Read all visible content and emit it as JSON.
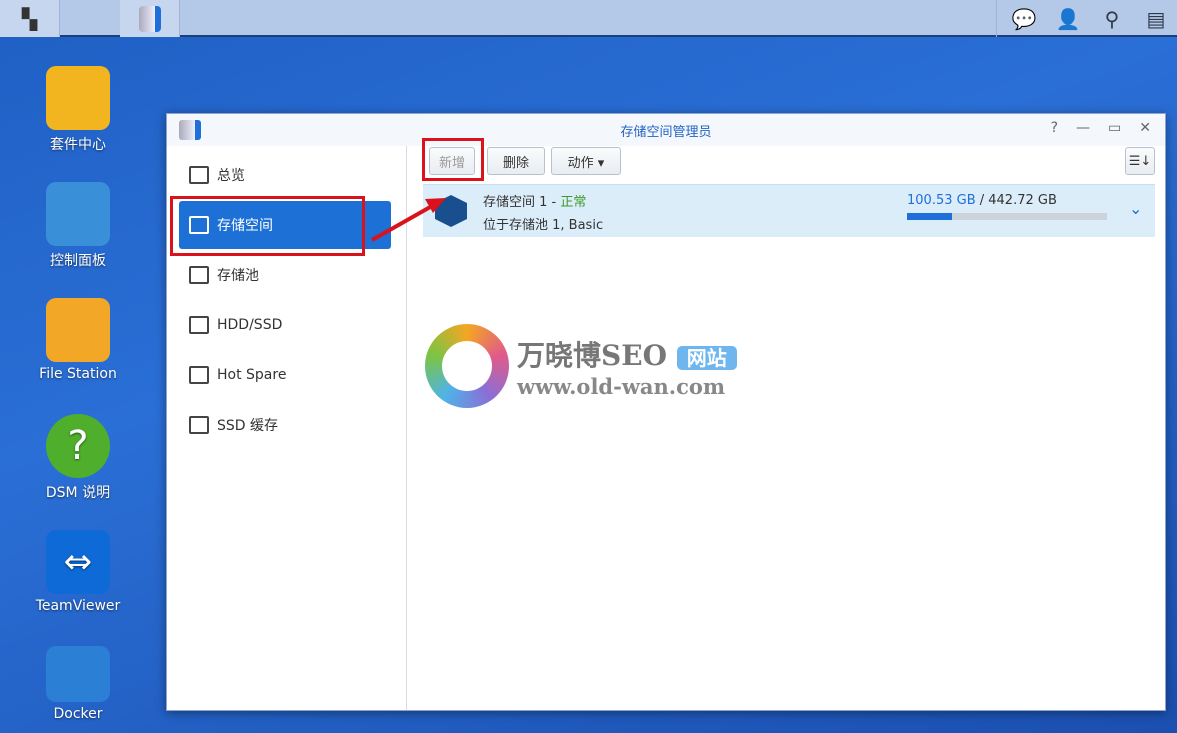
{
  "taskbar": {
    "main_menu_icon": "grid-icon",
    "app_icon": "storage-manager-icon",
    "right_icons": [
      "chat-icon",
      "user-icon",
      "search-icon",
      "widgets-icon"
    ]
  },
  "desktop": [
    {
      "label": "套件中心",
      "color": "#f3b51f"
    },
    {
      "label": "控制面板",
      "color": "#3a8fd9"
    },
    {
      "label": "File Station",
      "color": "#f2a826"
    },
    {
      "label": "DSM 说明",
      "color": "#4fae2c"
    },
    {
      "label": "TeamViewer",
      "color": "#0e6ad6"
    },
    {
      "label": "Docker",
      "color": "#2b7fd4"
    }
  ],
  "window": {
    "title": "存储空间管理员",
    "controls": [
      "?",
      "—",
      "▭",
      "✕"
    ]
  },
  "sidebar": {
    "items": [
      {
        "label": "总览"
      },
      {
        "label": "存储空间"
      },
      {
        "label": "存储池"
      },
      {
        "label": "HDD/SSD"
      },
      {
        "label": "Hot Spare"
      },
      {
        "label": "SSD 缓存"
      }
    ],
    "active": 1
  },
  "toolbar": {
    "create": "新增",
    "delete": "删除",
    "action": "动作 ▾",
    "sort_icon": "sort-icon"
  },
  "volume": {
    "name": "存储空间 1",
    "sep": " - ",
    "status": "正常",
    "location": "位于存储池 1, Basic",
    "used": "100.53 GB",
    "total": " / 442.72 GB",
    "usage_percent": 22.7,
    "status_color": "#3a9a2a",
    "used_color": "#1e6fd9"
  },
  "watermark": {
    "title": "万晓博SEO",
    "badge": "网站",
    "url": "www.old-wan.com"
  }
}
